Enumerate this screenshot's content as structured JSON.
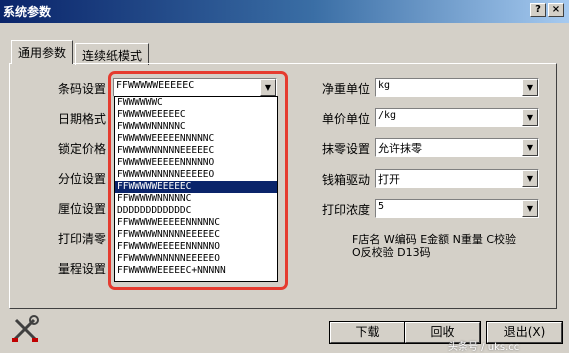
{
  "window": {
    "title": "系统参数",
    "help_label": "?",
    "close_label": "×"
  },
  "tabs": [
    {
      "label": "通用参数",
      "active": true
    },
    {
      "label": "连续纸模式",
      "active": false
    }
  ],
  "left_fields": [
    {
      "label": "条码设置",
      "value": "FFWWWWWEEEEEC"
    },
    {
      "label": "日期格式"
    },
    {
      "label": "锁定价格"
    },
    {
      "label": "分位设置"
    },
    {
      "label": "厘位设置"
    },
    {
      "label": "打印清零"
    },
    {
      "label": "量程设置"
    }
  ],
  "barcode_options": [
    "FWWWWWWC",
    "FWWWWWEEEEEC",
    "FWWWWWNNNNNC",
    "FWWWWWEEEEENNNNNC",
    "FWWWWWNNNNNEEEEEC",
    "FWWWWWEEEEENNNNNO",
    "FWWWWWNNNNNEEEEEO",
    "FFWWWWWEEEEEC",
    "FFWWWWWNNNNNC",
    "DDDDDDDDDDDDC",
    "FFWWWWWEEEEENNNNNC",
    "FFWWWWWNNNNNEEEEEC",
    "FFWWWWWEEEEENNNNNO",
    "FFWWWWWNNNNNEEEEEO",
    "FFWWWWWEEEEEC+NNNNN"
  ],
  "selected_option_index": 7,
  "right_fields": [
    {
      "label": "净重单位",
      "value": "kg"
    },
    {
      "label": "单价单位",
      "value": "/kg"
    },
    {
      "label": "抹零设置",
      "value": "允许抹零"
    },
    {
      "label": "钱箱驱动",
      "value": "打开"
    },
    {
      "label": "打印浓度",
      "value": "5"
    }
  ],
  "legend": {
    "line1": "F店名 W编码 E金额 N重量 C校验",
    "line2": "O反校验 D13码"
  },
  "buttons": {
    "download": "下载",
    "readback": "回收",
    "exit": "退出(X)"
  },
  "watermark": "头条号 / uks.cc",
  "icons": {
    "dropdown_arrow": "▼",
    "tools": "tools-icon"
  },
  "colors": {
    "title_bar": "#0a246a",
    "highlight": "#e53b2f",
    "selection": "#0a246a"
  }
}
